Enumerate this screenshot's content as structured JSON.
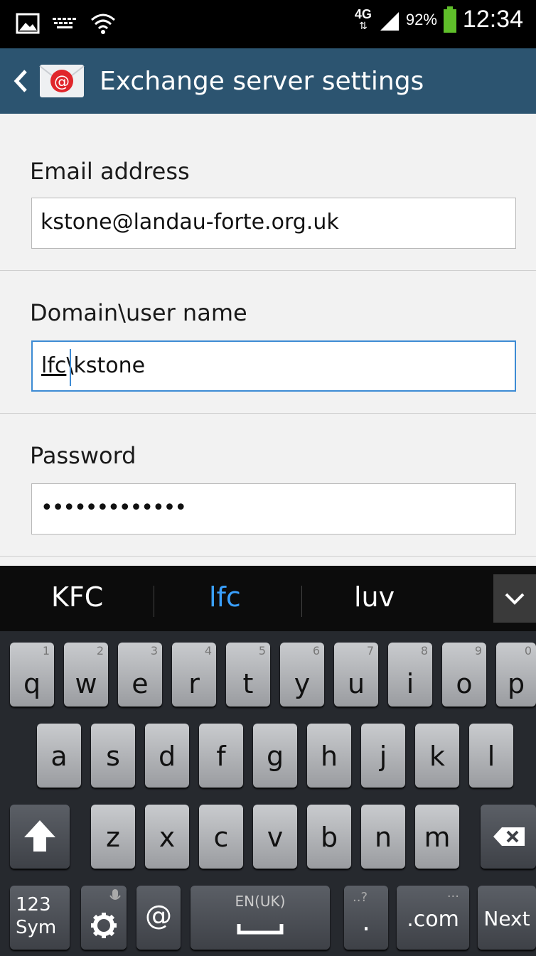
{
  "status_bar": {
    "network": "4G",
    "battery_text": "92%",
    "clock": "12:34",
    "icons": [
      "picture-icon",
      "keyboard-icon",
      "wifi-icon",
      "signal-icon",
      "battery-icon"
    ]
  },
  "action_bar": {
    "title": "Exchange server settings",
    "icons": [
      "back-chevron-icon",
      "email-app-icon"
    ]
  },
  "form": {
    "email_label": "Email address",
    "email_value": "kstone@landau-forte.org.uk",
    "username_label": "Domain\\user name",
    "username_value_underlined": "lfc",
    "username_value_rest": "\\kstone",
    "password_label": "Password",
    "password_value": "•••••••••••••"
  },
  "keyboard": {
    "suggestions": [
      "KFC",
      "lfc",
      "luv"
    ],
    "row1": [
      "q",
      "w",
      "e",
      "r",
      "t",
      "y",
      "u",
      "i",
      "o",
      "p"
    ],
    "row1_hints": [
      "1",
      "2",
      "3",
      "4",
      "5",
      "6",
      "7",
      "8",
      "9",
      "0"
    ],
    "row2": [
      "a",
      "s",
      "d",
      "f",
      "g",
      "h",
      "j",
      "k",
      "l"
    ],
    "row3": [
      "z",
      "x",
      "c",
      "v",
      "b",
      "n",
      "m"
    ],
    "sym_top": "123",
    "sym_bottom": "Sym",
    "at_key": "@",
    "space_label": "EN(UK)",
    "period_key": ".",
    "period_hint": "..?",
    "dotcom_key": ".com",
    "dotcom_hint": "...",
    "next_key": "Next",
    "colors": {
      "accent": "#3d8bd4",
      "action_bar": "#2c5470",
      "suggestion_active": "#3aa0ff"
    }
  }
}
